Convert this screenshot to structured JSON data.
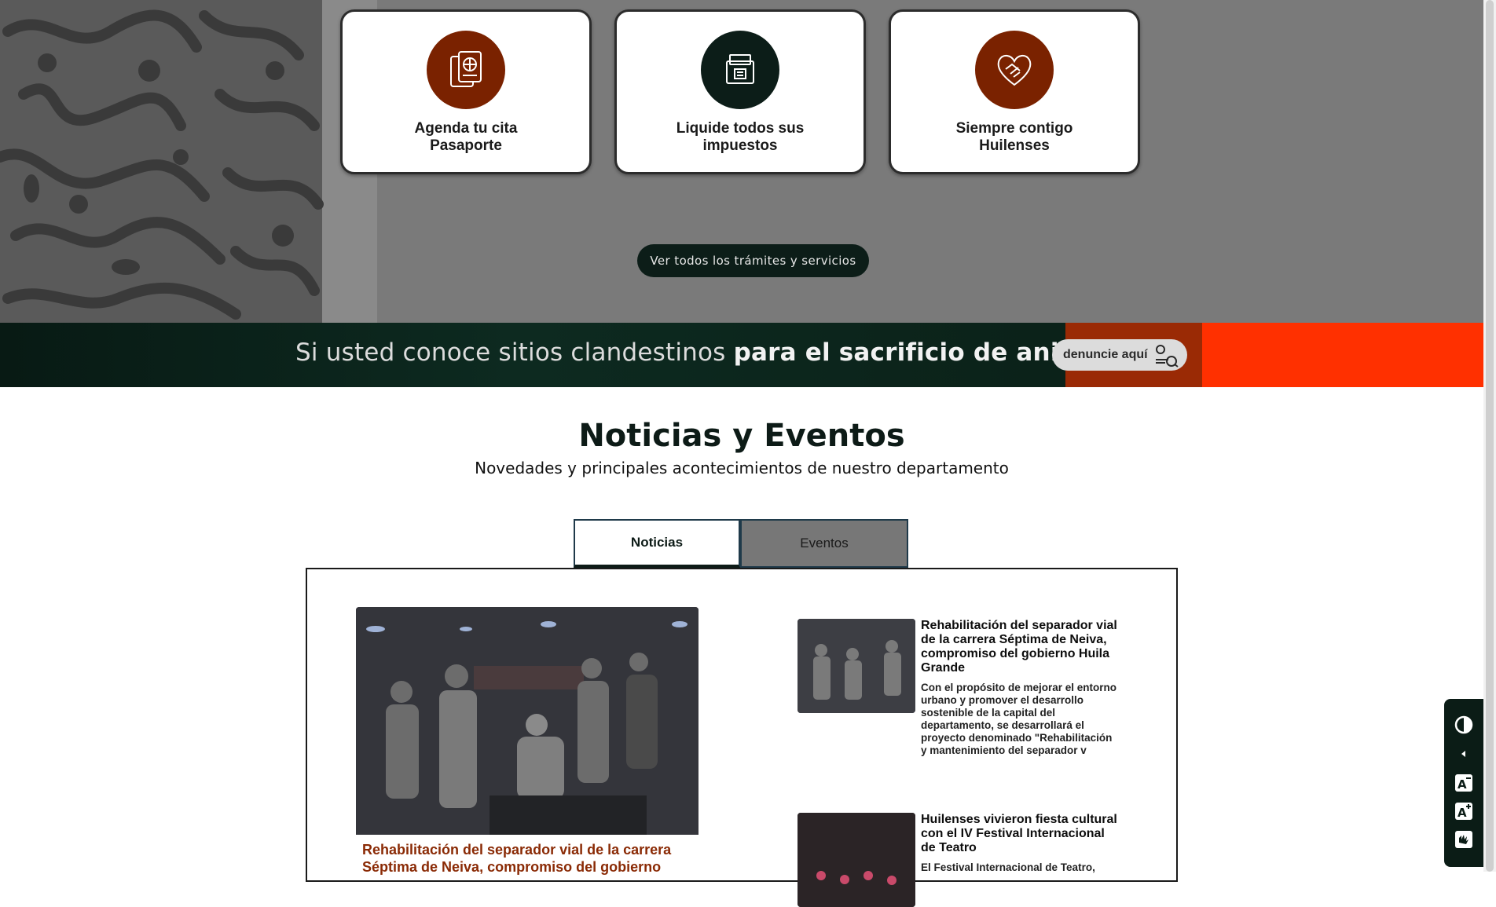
{
  "services": {
    "cards": [
      {
        "line1": "Agenda tu cita",
        "line2": "Pasaporte",
        "icon": "passport-icon",
        "color": "#7a2200"
      },
      {
        "line1": "Liquide todos sus",
        "line2": "impuestos",
        "icon": "tax-folder-icon",
        "color": "#0c1d18"
      },
      {
        "line1": "Siempre contigo",
        "line2": "Huilenses",
        "icon": "heart-handshake-icon",
        "color": "#7a2200"
      }
    ],
    "view_all": "Ver todos los trámites y servicios"
  },
  "banner": {
    "text_light": "Si usted conoce sitios clandestinos",
    "text_bold": "para el sacrificio de animales",
    "button": "denuncie aquí"
  },
  "news": {
    "title": "Noticias y Eventos",
    "subtitle": "Novedades y principales acontecimientos de nuestro departamento",
    "tabs": [
      "Noticias",
      "Eventos"
    ],
    "main_headline": "Rehabilitación del separador vial de la carrera Séptima de Neiva, compromiso del gobierno",
    "side_items": [
      {
        "title": "Rehabilitación del separador vial de la carrera Séptima de Neiva, compromiso del gobierno Huila Grande",
        "desc": "Con el propósito de mejorar el entorno urbano y promover el desarrollo sostenible de la capital del departamento, se desarrollará el proyecto denominado \"Rehabilitación y mantenimiento del separador v"
      },
      {
        "title": "Huilenses vivieron fiesta cultural con el IV Festival Internacional de Teatro",
        "desc": "El Festival Internacional de Teatro,"
      }
    ]
  },
  "accessibility": {
    "buttons": [
      "contrast-icon",
      "collapse-icon",
      "font-decrease-icon",
      "font-increase-icon",
      "sign-language-icon"
    ]
  }
}
